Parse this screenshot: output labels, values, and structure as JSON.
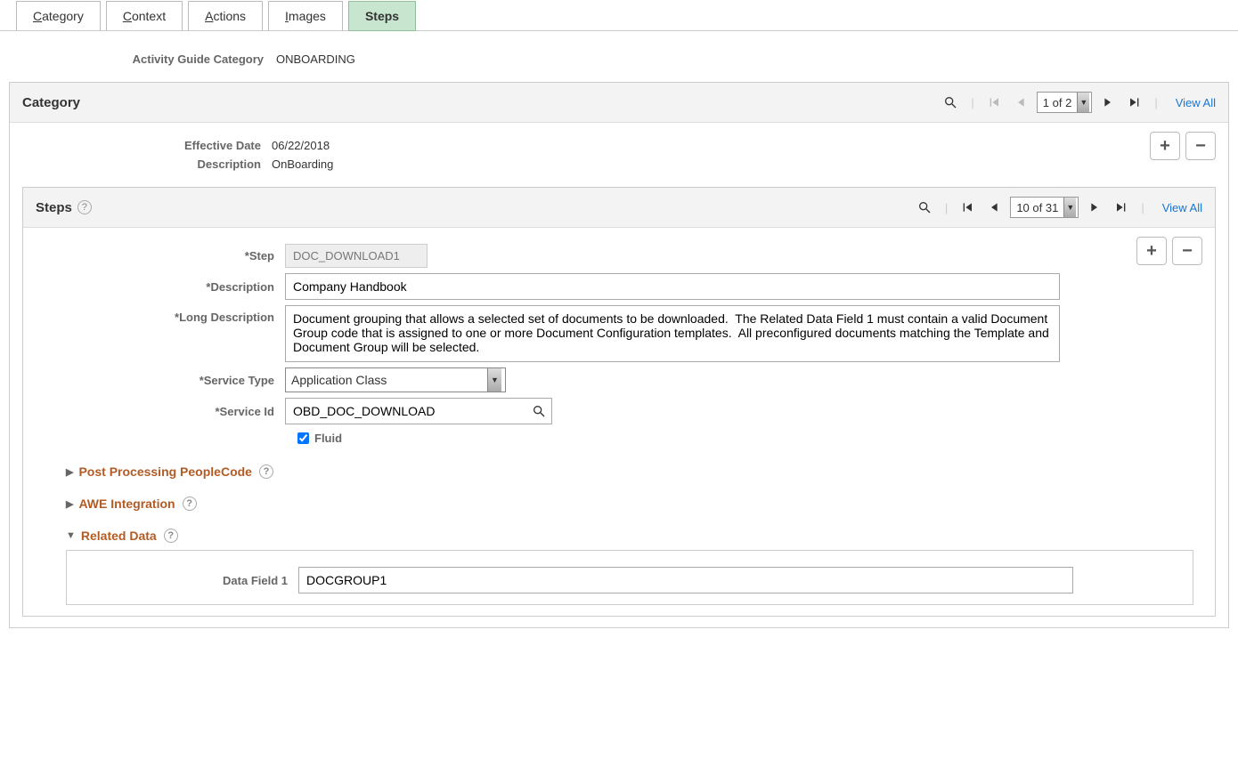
{
  "tabs": {
    "category": "Category",
    "context": "Context",
    "actions": "Actions",
    "images": "Images",
    "steps": "Steps"
  },
  "header": {
    "activity_guide_category_label": "Activity Guide Category",
    "activity_guide_category_value": "ONBOARDING"
  },
  "category_section": {
    "title": "Category",
    "pager": "1 of 2",
    "view_all": "View All",
    "effective_date_label": "Effective Date",
    "effective_date_value": "06/22/2018",
    "description_label": "Description",
    "description_value": "OnBoarding"
  },
  "steps_section": {
    "title": "Steps",
    "pager": "10 of 31",
    "view_all": "View All",
    "fields": {
      "step_label": "*Step",
      "step_value": "DOC_DOWNLOAD1",
      "description_label": "*Description",
      "description_value": "Company Handbook",
      "long_description_label": "*Long Description",
      "long_description_value": "Document grouping that allows a selected set of documents to be downloaded.  The Related Data Field 1 must contain a valid Document Group code that is assigned to one or more Document Configuration templates.  All preconfigured documents matching the Template and Document Group will be selected.",
      "service_type_label": "*Service Type",
      "service_type_value": "Application Class",
      "service_id_label": "*Service Id",
      "service_id_value": "OBD_DOC_DOWNLOAD",
      "fluid_label": "Fluid"
    },
    "collapsible": {
      "post_processing": "Post Processing PeopleCode",
      "awe_integration": "AWE Integration",
      "related_data": "Related Data"
    },
    "related_data": {
      "field1_label": "Data Field 1",
      "field1_value": "DOCGROUP1"
    }
  }
}
